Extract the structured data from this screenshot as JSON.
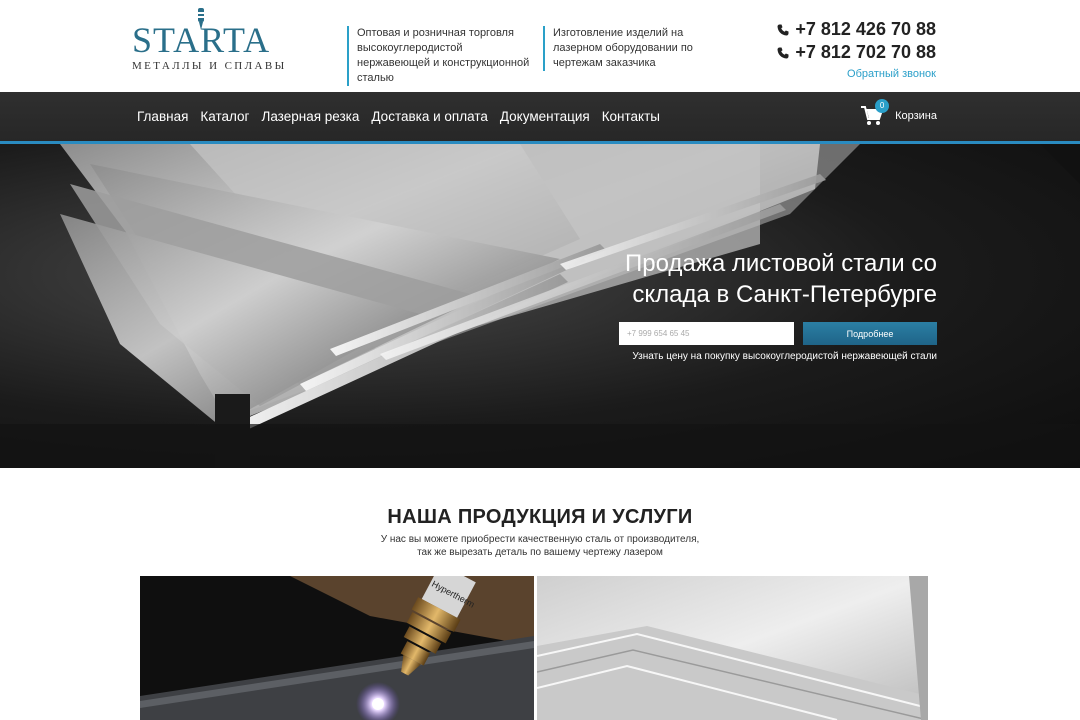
{
  "header": {
    "logo": {
      "name": "STARTA",
      "subtitle": "МЕТАЛЛЫ И СПЛАВЫ"
    },
    "taglines": [
      "Оптовая и розничная торговля высокоуглеродистой нержавеющей и конструкционной сталью",
      "Изготовление изделий на лазерном оборудовании по чертежам заказчика"
    ],
    "phones": [
      "+7 812 426 70 88",
      "+7 812 702 70 88"
    ],
    "callback_label": "Обратный звонок",
    "icons": {
      "phone": "phone-icon",
      "cart": "cart-icon"
    },
    "colors": {
      "accent": "#2a9fc9",
      "nav_bg": "#2f2f2f",
      "logo": "#2a6f8a"
    }
  },
  "nav": {
    "items": [
      "Главная",
      "Каталог",
      "Лазерная резка",
      "Доставка и оплата",
      "Документация",
      "Контакты"
    ],
    "cart": {
      "label": "Корзина",
      "count": "0"
    }
  },
  "hero": {
    "title": "Продажа листовой стали со склада в Санкт-Петербурге",
    "phone_placeholder": "+7 999 654 65 45",
    "button_label": "Подробнее",
    "note": "Узнать цену на покупку высокоуглеродистой нержавеющей стали"
  },
  "products": {
    "title": "НАША ПРОДУКЦИЯ И УСЛУГИ",
    "subtitle_line1": "У нас вы можете приобрести качественную сталь от производителя,",
    "subtitle_line2": "так же вырезать деталь по вашему чертежу лазером",
    "laser_brand": "Hypertherm"
  }
}
